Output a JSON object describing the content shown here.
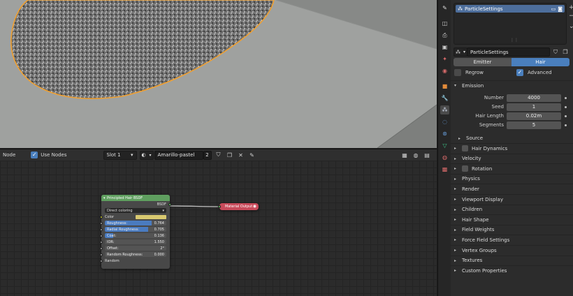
{
  "node_editor": {
    "header": {
      "editor_label": "Node",
      "use_nodes_label": "Use Nodes",
      "slot": "Slot 1",
      "material_name": "Amarillo-pastel",
      "user_count": "2"
    },
    "bsdf_node": {
      "title": "Principled Hair BSDF",
      "output_label": "BSDF",
      "coloring": "Direct coloring",
      "color_label": "Color",
      "color_value": "#d9c970",
      "fields": [
        {
          "label": "Roughness:",
          "value": "0.764",
          "fill": 0.764
        },
        {
          "label": "Radial Roughness:",
          "value": "0.705",
          "fill": 0.705
        },
        {
          "label": "Coat:",
          "value": "0.136",
          "fill": 0.136
        },
        {
          "label": "IOR:",
          "value": "1.550"
        },
        {
          "label": "Offset:",
          "value": "2°"
        },
        {
          "label": "Random Roughness:",
          "value": "0.000"
        }
      ],
      "random_label": "Random"
    },
    "output_node": {
      "title": "Material Output"
    }
  },
  "properties": {
    "particle_system_item": "ParticleSettings",
    "particle_settings_name": "ParticleSettings",
    "type_tabs": [
      "Emitter",
      "Hair"
    ],
    "regrow_label": "Regrow",
    "advanced_label": "Advanced",
    "emission": {
      "title": "Emission",
      "rows": [
        {
          "label": "Number",
          "value": "4000"
        },
        {
          "label": "Seed",
          "value": "1"
        },
        {
          "label": "Hair Length",
          "value": "0.02m"
        },
        {
          "label": "Segments",
          "value": "5"
        }
      ],
      "source_label": "Source"
    },
    "panels": [
      {
        "label": "Hair Dynamics",
        "checkbox": true
      },
      {
        "label": "Velocity",
        "checkbox": false
      },
      {
        "label": "Rotation",
        "checkbox": true
      },
      {
        "label": "Physics",
        "checkbox": false
      },
      {
        "label": "Render",
        "checkbox": false
      },
      {
        "label": "Viewport Display",
        "checkbox": false
      },
      {
        "label": "Children",
        "checkbox": false
      },
      {
        "label": "Hair Shape",
        "checkbox": false
      },
      {
        "label": "Field Weights",
        "checkbox": false
      },
      {
        "label": "Force Field Settings",
        "checkbox": false
      },
      {
        "label": "Vertex Groups",
        "checkbox": false
      },
      {
        "label": "Textures",
        "checkbox": false
      },
      {
        "label": "Custom Properties",
        "checkbox": false
      }
    ]
  },
  "colors": {
    "accent": "#4a7fbd",
    "selection_outline": "#f0a030",
    "output_node": "#c84a5a",
    "bsdf_header": "#5f9f5f"
  }
}
